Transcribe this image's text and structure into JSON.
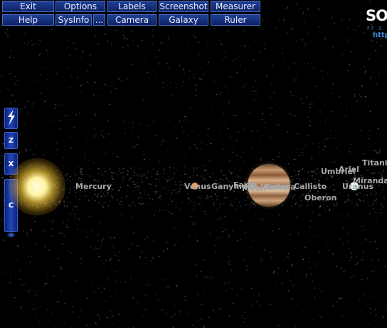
{
  "toolbar": {
    "row1": [
      "Exit",
      "Options",
      "Labels",
      "Screenshot",
      "Measurer"
    ],
    "row2": [
      "Help",
      "SysInfo",
      "...",
      "Camera",
      "Galaxy",
      "Ruler"
    ]
  },
  "logo": {
    "text": "SO",
    "subtext": "FF S",
    "url": "http"
  },
  "side_controls": {
    "top_icon": "lightning-icon",
    "keys": [
      "Z",
      "X",
      "C"
    ]
  },
  "labels": {
    "mercury": "Mercury",
    "venus": "Venus",
    "ganymede": "Ganymede",
    "earth": "Earth",
    "io": "Io",
    "moon": "Moon",
    "jupiter": "Jupiter",
    "europa": "Europa",
    "callisto": "Callisto",
    "oberon": "Oberon",
    "umbriel": "Umbriel",
    "ariel": "Ariel",
    "titania": "Titania",
    "miranda": "Miranda",
    "uranus": "Uranus"
  },
  "colors": {
    "button_bg": "#1a3a8f",
    "button_border": "#4d6fc4",
    "label_gray": "#a8a8a8",
    "sun_glow": "#fff3a0",
    "background": "#000000"
  }
}
